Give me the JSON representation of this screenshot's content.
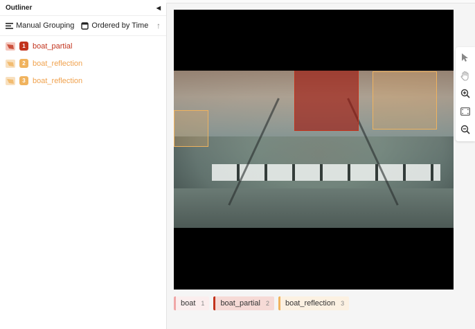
{
  "outliner": {
    "title": "Outliner",
    "collapse_glyph": "◀",
    "grouping_label": "Manual Grouping",
    "ordering_label": "Ordered by Time",
    "sort_glyph": "↑",
    "items": [
      {
        "index": "1",
        "label": "boat_partial",
        "color": "#c2331d",
        "text_color": "#c2331d"
      },
      {
        "index": "2",
        "label": "boat_reflection",
        "color": "#f0b35e",
        "text_color": "#f0a24e"
      },
      {
        "index": "3",
        "label": "boat_reflection",
        "color": "#f0b35e",
        "text_color": "#f0a24e"
      }
    ]
  },
  "labels": [
    {
      "name": "boat",
      "count": "1",
      "color": "#f0a7a7",
      "bg": "#fbeeee"
    },
    {
      "name": "boat_partial",
      "count": "2",
      "color": "#c2331d",
      "bg": "#f6dad6"
    },
    {
      "name": "boat_reflection",
      "count": "3",
      "color": "#f0b35e",
      "bg": "#fcf1e2"
    }
  ],
  "tools": [
    "pointer-icon",
    "pan-hand-icon",
    "zoom-in-icon",
    "fit-screen-icon",
    "zoom-out-icon"
  ]
}
